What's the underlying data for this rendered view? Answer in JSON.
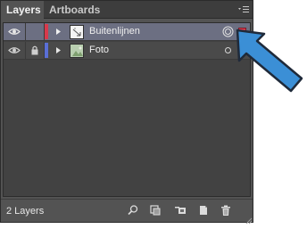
{
  "panel": {
    "tabs": [
      {
        "label": "Layers"
      },
      {
        "label": "Artboards"
      }
    ]
  },
  "layers": [
    {
      "name": "Buitenlijnen",
      "visible": true,
      "locked": false,
      "color": "#d8394c",
      "selected": true,
      "thumb_icon": "arrow-sketch-icon"
    },
    {
      "name": "Foto",
      "visible": true,
      "locked": true,
      "color": "#5a6fd6",
      "selected": false,
      "thumb_icon": "photo-thumb-icon"
    }
  ],
  "footer": {
    "count_label": "2 Layers"
  },
  "colors": {
    "selection_highlight": "#6c6f82",
    "pointer_arrow": "#3b8fd6"
  }
}
